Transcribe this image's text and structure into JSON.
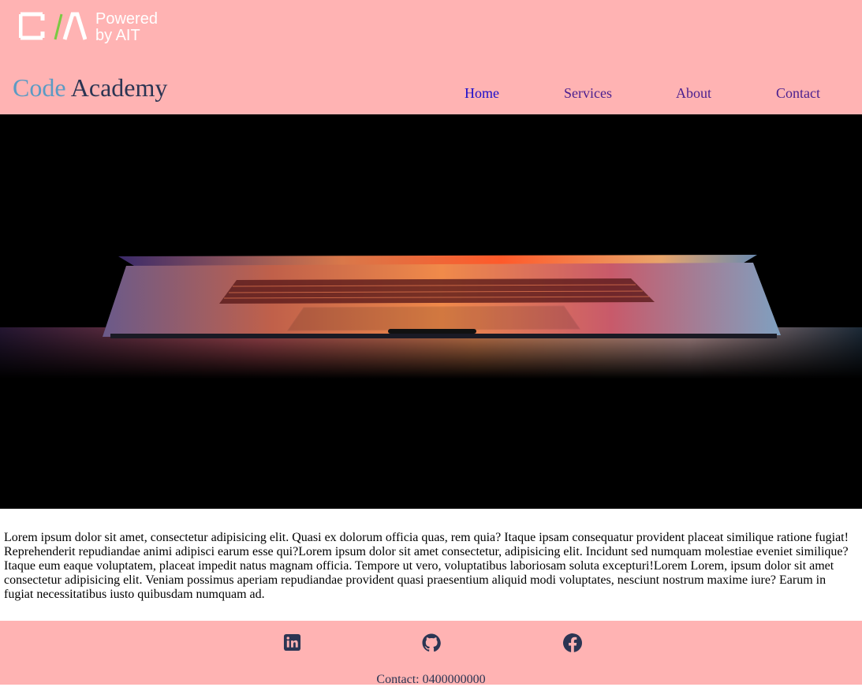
{
  "header": {
    "logo": {
      "text_line1": "Powered",
      "text_line2": "by AIT"
    },
    "brand": {
      "part1": "Code",
      "part2": "Academy"
    },
    "nav": [
      {
        "label": "Home",
        "color": "#1a0dcc"
      },
      {
        "label": "Services",
        "color": "#4a1f8f"
      },
      {
        "label": "About",
        "color": "#4a1f8f"
      },
      {
        "label": "Contact",
        "color": "#4a1f8f"
      }
    ]
  },
  "hero": {
    "icon": "laptop-photo"
  },
  "main": {
    "paragraph": "Lorem ipsum dolor sit amet, consectetur adipisicing elit. Quasi ex dolorum officia quas, rem quia? Itaque ipsam consequatur provident placeat similique ratione fugiat! Reprehenderit repudiandae animi adipisci earum esse qui?Lorem ipsum dolor sit amet consectetur, adipisicing elit. Incidunt sed numquam molestiae eveniet similique? Itaque eum eaque voluptatem, placeat impedit natus magnam officia. Tempore ut vero, voluptatibus laboriosam soluta excepturi!Lorem Lorem, ipsum dolor sit amet consectetur adipisicing elit. Veniam possimus aperiam repudiandae provident quasi praesentium aliquid modi voluptates, nesciunt nostrum maxime iure? Earum in fugiat necessitatibus iusto quibusdam numquam ad."
  },
  "footer": {
    "social": [
      {
        "icon": "linkedin-icon"
      },
      {
        "icon": "github-icon"
      },
      {
        "icon": "facebook-icon"
      }
    ],
    "contact": "Contact: 0400000000"
  },
  "colors": {
    "header_bg": "#ffb3b3",
    "brand_code": "#5b9bc4",
    "brand_academy": "#2b3553",
    "icon": "#2b3553"
  }
}
